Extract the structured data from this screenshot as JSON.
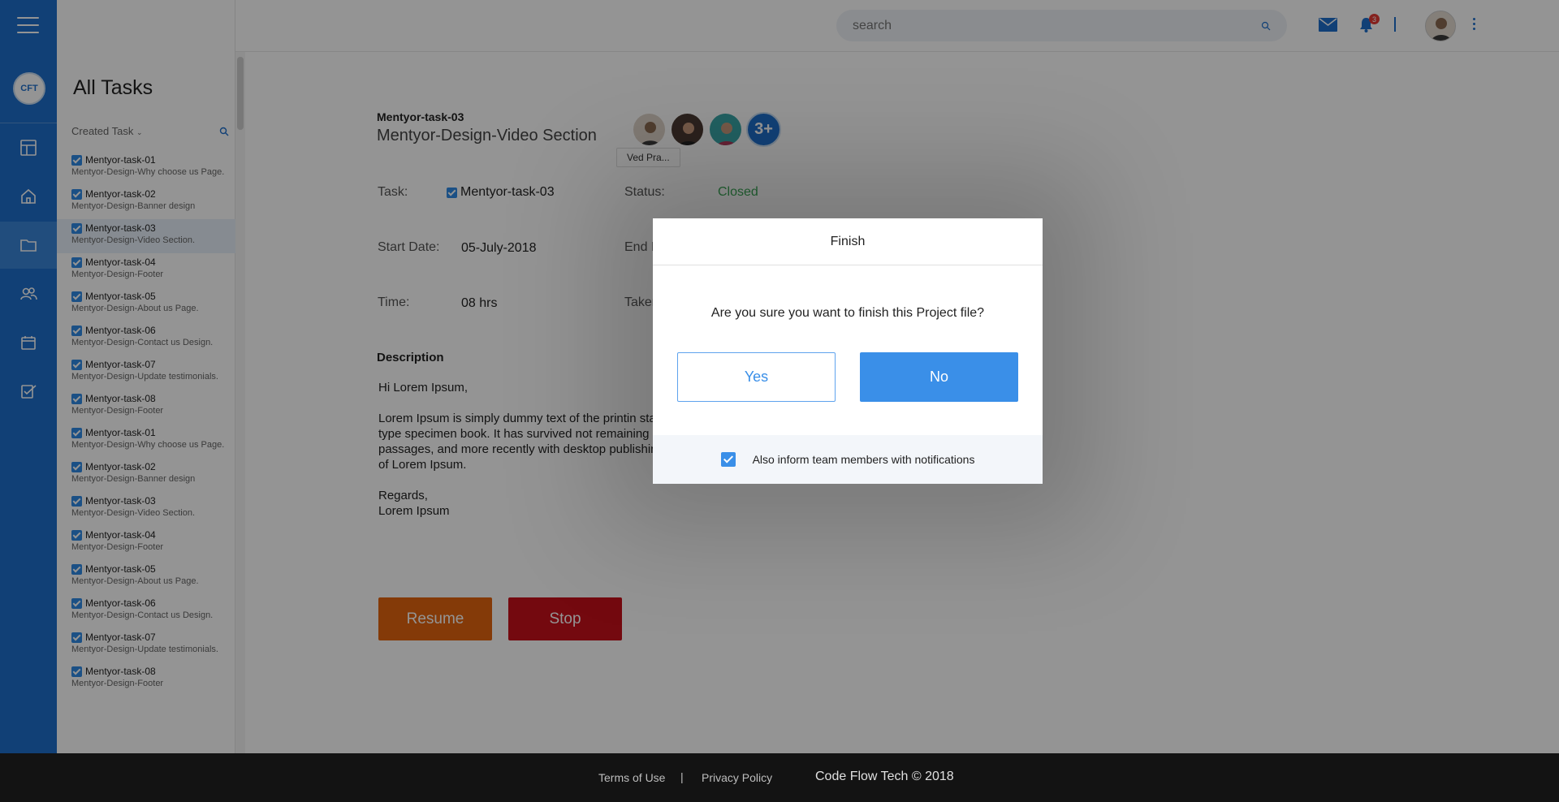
{
  "panel": {
    "title": "All Tasks",
    "filter_label": "Created Task"
  },
  "tasks": [
    {
      "name": "Mentyor-task-01",
      "desc": "Mentyor-Design-Why choose us Page."
    },
    {
      "name": "Mentyor-task-02",
      "desc": "Mentyor-Design-Banner design"
    },
    {
      "name": "Mentyor-task-03",
      "desc": "Mentyor-Design-Video Section."
    },
    {
      "name": "Mentyor-task-04",
      "desc": "Mentyor-Design-Footer"
    },
    {
      "name": "Mentyor-task-05",
      "desc": "Mentyor-Design-About us Page."
    },
    {
      "name": "Mentyor-task-06",
      "desc": "Mentyor-Design-Contact us Design."
    },
    {
      "name": "Mentyor-task-07",
      "desc": "Mentyor-Design-Update testimonials."
    },
    {
      "name": "Mentyor-task-08",
      "desc": "Mentyor-Design-Footer"
    },
    {
      "name": "Mentyor-task-01",
      "desc": "Mentyor-Design-Why choose us Page."
    },
    {
      "name": "Mentyor-task-02",
      "desc": "Mentyor-Design-Banner design"
    },
    {
      "name": "Mentyor-task-03",
      "desc": "Mentyor-Design-Video Section."
    },
    {
      "name": "Mentyor-task-04",
      "desc": "Mentyor-Design-Footer"
    },
    {
      "name": "Mentyor-task-05",
      "desc": "Mentyor-Design-About us Page."
    },
    {
      "name": "Mentyor-task-06",
      "desc": "Mentyor-Design-Contact us Design."
    },
    {
      "name": "Mentyor-task-07",
      "desc": "Mentyor-Design-Update testimonials."
    },
    {
      "name": "Mentyor-task-08",
      "desc": "Mentyor-Design-Footer"
    }
  ],
  "search": {
    "placeholder": "search"
  },
  "notifications": {
    "count": "3"
  },
  "detail": {
    "breadcrumb": "Mentyor-task-03",
    "title": "Mentyor-Design-Video Section",
    "team_more": "3+",
    "tooltip": "Ved Pra...",
    "task_label": "Task:",
    "task_value": "Mentyor-task-03",
    "status_label": "Status:",
    "status_value": "Closed",
    "start_label": "Start Date:",
    "start_value": "05-July-2018",
    "end_label": "End I",
    "time_label": "Time:",
    "time_value": "08 hrs",
    "taken_label": "Taken",
    "description_heading": "Description",
    "greeting": "Hi Lorem Ipsum,",
    "body": "Lorem Ipsum is simply dummy text of the printin standard dummy text ever since the 1500s, whe make a type specimen book. It has survived not remaining essentially unchanged. It was popular Lorem Ipsum passages, and more recently with desktop publishing software like Aldus PageMaker including versions of Lorem Ipsum.",
    "regards": "Regards,",
    "signature": "Lorem Ipsum",
    "resume_label": "Resume",
    "stop_label": "Stop"
  },
  "dialog": {
    "title": "Finish",
    "message": "Are you sure you want to finish this Project file?",
    "yes_label": "Yes",
    "no_label": "No",
    "notify_label": "Also inform team members with notifications"
  },
  "footer": {
    "terms": "Terms of Use",
    "separator": "|",
    "privacy": "Privacy Policy",
    "brand": "Code Flow Tech © 2018"
  },
  "colors": {
    "rail": "#1e6fcb",
    "primary": "#3a8fe8",
    "resume": "#e3650f",
    "stop": "#c8101b",
    "closed": "#3aa856"
  }
}
